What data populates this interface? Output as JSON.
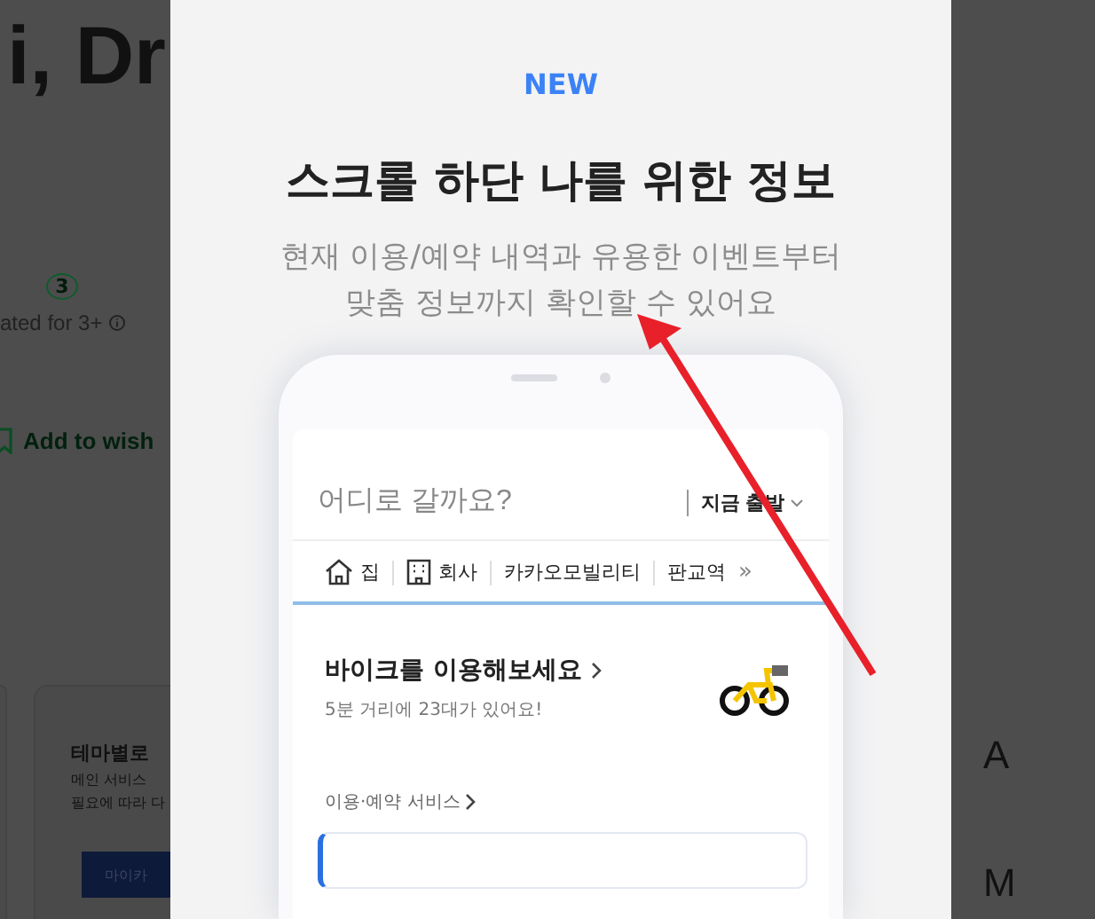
{
  "background_page": {
    "title": "i, Dr",
    "rating_badge": "3",
    "rating_label": "ated for 3+",
    "wishlist_link": "Add to wish",
    "cards": [
      {
        "title": "테마별로",
        "lines": [
          "메인 서비스",
          "필요에 따라 다"
        ],
        "button": "마이카"
      }
    ],
    "right_labels": [
      "A",
      "M"
    ]
  },
  "modal": {
    "badge": "NEW",
    "title": "스크롤 하단 나를 위한 정보",
    "subtitle_lines": [
      "현재 이용/예약 내역과 유용한 이벤트부터",
      "맞춤 정보까지 확인할 수 있어요"
    ],
    "phone": {
      "search_placeholder": "어디로 갈까요?",
      "departure": "지금 출발",
      "places": [
        {
          "kind": "home",
          "label": "집"
        },
        {
          "kind": "office",
          "label": "회사"
        },
        {
          "kind": "text",
          "label": "카카오모빌리티"
        },
        {
          "kind": "text",
          "label": "판교역"
        }
      ],
      "more": "»",
      "bike": {
        "title": "바이크를 이용해보세요",
        "subtitle": "5분 거리에 23대가 있어요!"
      },
      "services_link": "이용·예약 서비스"
    }
  }
}
